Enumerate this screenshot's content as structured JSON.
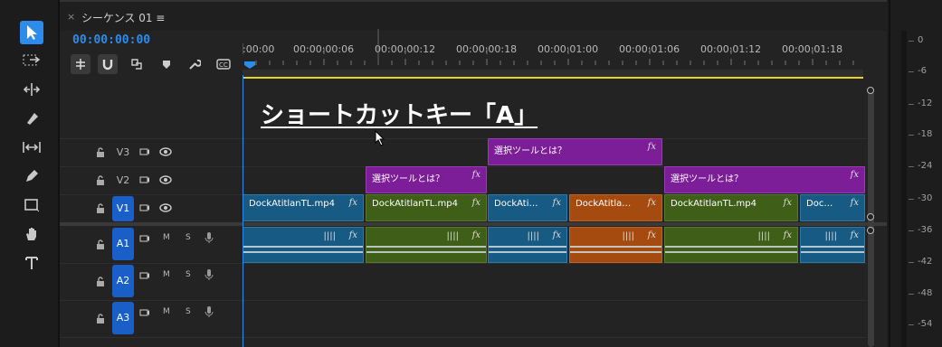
{
  "sequence": {
    "tab_close": "×",
    "tab_title": "シーケンス 01 ≡",
    "timecode": "00:00:00:00"
  },
  "ruler": {
    "labels": [
      ":00:00",
      "00:00:00:06",
      "00:00:00:12",
      "00:00:00:18",
      "00:00:01:00",
      "00:00:01:06",
      "00:00:01:12",
      "00:00:01:18"
    ]
  },
  "overlay_title": "ショートカットキー「A」",
  "tracks": {
    "video": [
      {
        "name": "V3"
      },
      {
        "name": "V2"
      },
      {
        "name": "V1"
      }
    ],
    "audio": [
      {
        "name": "A1",
        "m": "M",
        "s": "S"
      },
      {
        "name": "A2",
        "m": "M",
        "s": "S"
      },
      {
        "name": "A3",
        "m": "M",
        "s": "S"
      }
    ]
  },
  "clips": {
    "v3": [
      {
        "label": "選択ツールとは？",
        "fx": "fx",
        "color": "purple"
      }
    ],
    "v2": [
      {
        "label": "選択ツールとは？",
        "fx": "fx",
        "color": "purple"
      },
      {
        "label": "選択ツールとは？",
        "fx": "fx",
        "color": "purple"
      }
    ],
    "v1": [
      {
        "label": "DockAtitlanTL.mp4",
        "fx": "fx",
        "color": "blue"
      },
      {
        "label": "DockAtitlanTL.mp4",
        "fx": "fx",
        "color": "green"
      },
      {
        "label": "DockAti…",
        "fx": "fx",
        "color": "blue"
      },
      {
        "label": "DockAtitla…",
        "fx": "fx",
        "color": "orange"
      },
      {
        "label": "DockAtitlanTL.mp4",
        "fx": "fx",
        "color": "green"
      },
      {
        "label": "Doc…",
        "fx": "fx",
        "color": "blue"
      }
    ],
    "a1_fx": "fx"
  },
  "meter": {
    "labels": [
      "0",
      "-6",
      "-12",
      "-18",
      "-24",
      "-30",
      "-36",
      "-42",
      "-48",
      "-54"
    ]
  },
  "colors": {
    "accent": "#2d8ceb",
    "purple_clip": "#7d1e99",
    "blue_clip": "#175a83",
    "green_clip": "#3f5f18",
    "orange_clip": "#a54b10",
    "work_area": "#e8d31a"
  },
  "icons": {
    "tools": [
      "selection-arrow-icon",
      "track-select-forward-icon",
      "ripple-edit-icon",
      "razor-icon",
      "slip-icon",
      "pen-icon",
      "rectangle-icon",
      "hand-icon",
      "type-icon"
    ],
    "timeline_buttons": [
      "insert-nest-icon",
      "snap-magnet-icon",
      "linked-selection-icon",
      "add-marker-icon",
      "settings-wrench-icon",
      "captions-icon"
    ]
  }
}
